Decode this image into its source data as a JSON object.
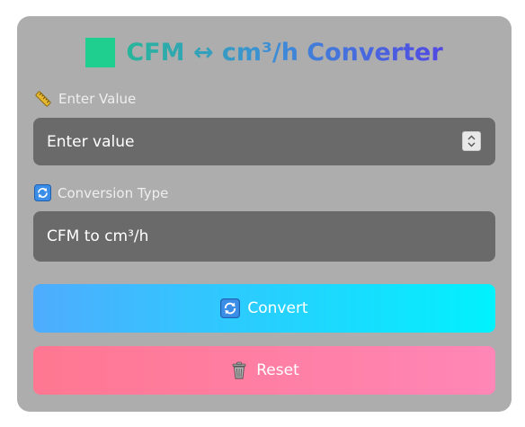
{
  "header": {
    "title": "CFM ↔ cm³/h Converter",
    "title_icon": "green-square-icon"
  },
  "value_field": {
    "label": "Enter Value",
    "label_icon": "ruler-icon",
    "placeholder": "Enter value"
  },
  "conversion_field": {
    "label": "Conversion Type",
    "label_icon": "sync-icon",
    "selected": "CFM to cm³/h"
  },
  "buttons": {
    "convert_label": "Convert",
    "convert_icon": "sync-icon",
    "reset_label": "Reset",
    "reset_icon": "trash-icon"
  },
  "colors": {
    "card": "#adadad",
    "input": "#6a6a6a",
    "convert_start": "#4facfe",
    "convert_end": "#00f2fe",
    "reset_start": "#ff7791",
    "reset_end": "#ff86b6",
    "title_square": "#1ecf8f"
  }
}
